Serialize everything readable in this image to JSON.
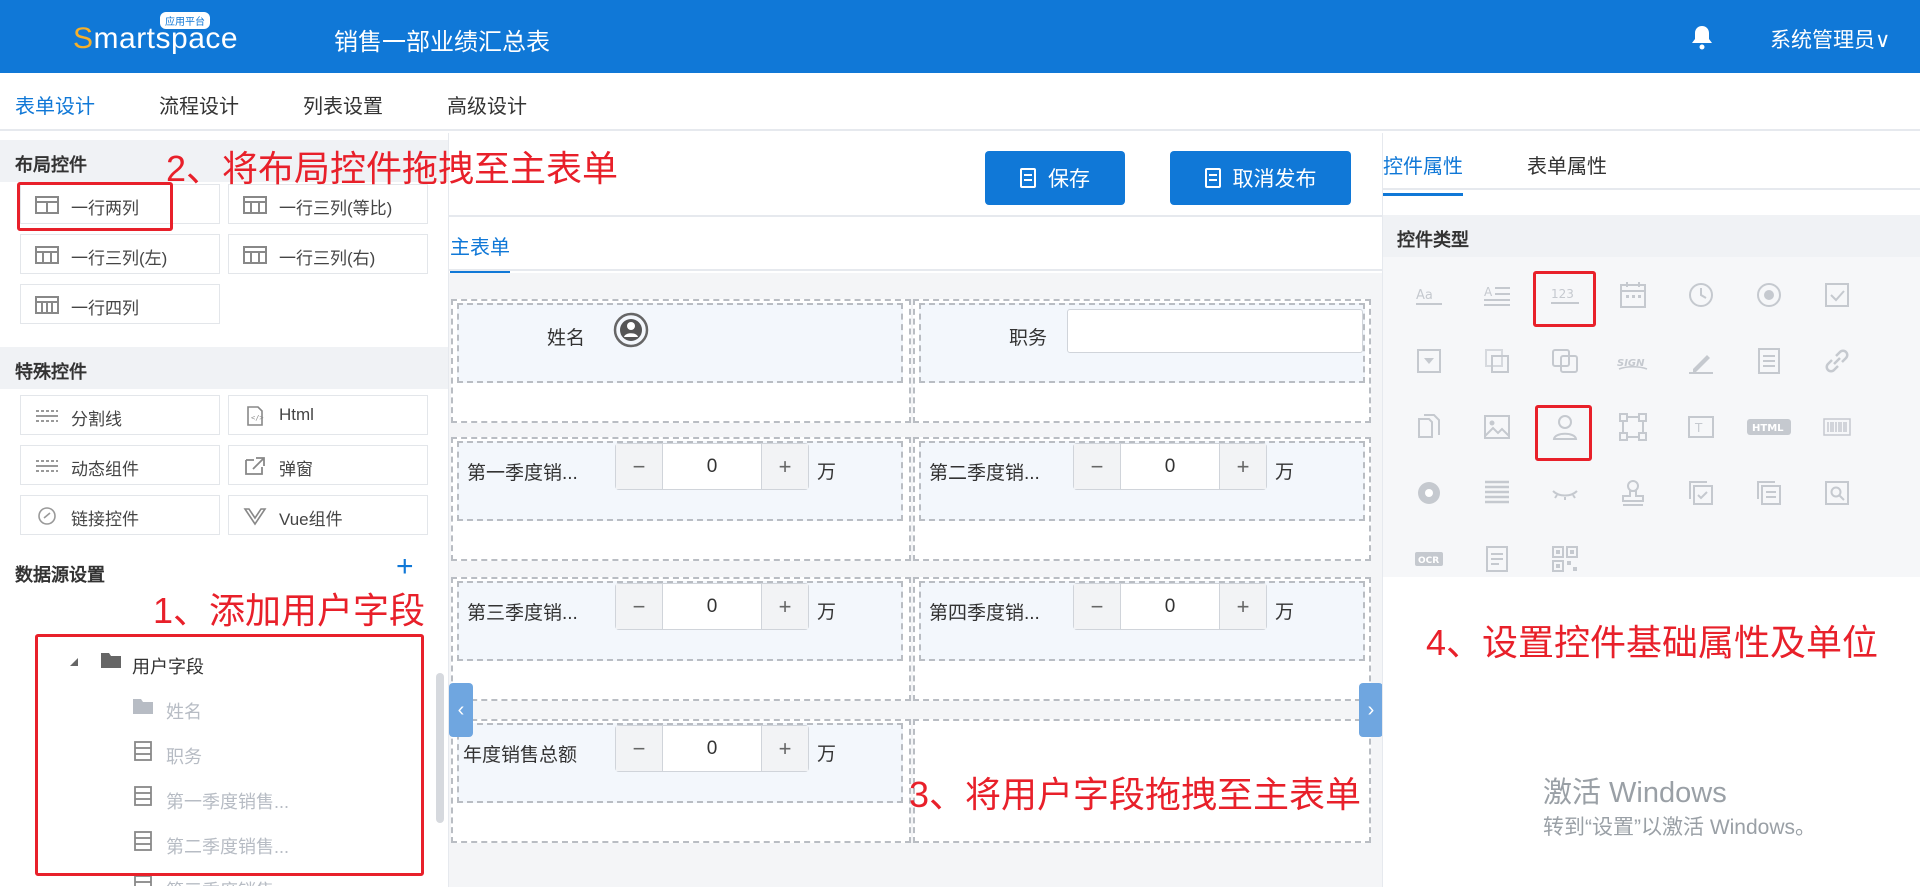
{
  "header": {
    "logo_text": "Smartspace",
    "logo_badge": "应用平台",
    "title": "销售一部业绩汇总表",
    "user_menu": "系统管理员∨",
    "bell_icon": "bell-icon",
    "accent_color": "#1078d7"
  },
  "main_tabs": [
    {
      "label": "表单设计",
      "active": true
    },
    {
      "label": "流程设计"
    },
    {
      "label": "列表设置"
    },
    {
      "label": "高级设计"
    }
  ],
  "left": {
    "layout_section": "布局控件",
    "layout_controls": [
      "一行两列",
      "一行三列(等比)",
      "一行三列(左)",
      "一行三列(右)",
      "一行四列"
    ],
    "special_section": "特殊控件",
    "special_controls": [
      "分割线",
      "Html",
      "动态组件",
      "弹窗",
      "链接控件",
      "Vue组件"
    ],
    "datasource_section": "数据源设置",
    "add_icon": "+",
    "tree": {
      "root": "用户字段",
      "children": [
        "姓名",
        "职务",
        "第一季度销售...",
        "第二季度销售...",
        "第三季度销售..."
      ]
    }
  },
  "center": {
    "save_button": "保存",
    "unpublish_button": "取消发布",
    "form_tab": "主表单",
    "fields": {
      "name_label": "姓名",
      "position_label": "职务",
      "q1_label": "第一季度销...",
      "q2_label": "第二季度销...",
      "q3_label": "第三季度销...",
      "q4_label": "第四季度销...",
      "total_label": "年度销售总额",
      "q1_value": "0",
      "q2_value": "0",
      "q3_value": "0",
      "q4_value": "0",
      "total_value": "0",
      "unit": "万",
      "minus": "−",
      "plus": "+"
    },
    "collapse_left": "‹",
    "collapse_right": "›"
  },
  "right": {
    "tabs": [
      {
        "label": "控件属性",
        "active": true
      },
      {
        "label": "表单属性"
      }
    ],
    "control_type_section": "控件类型",
    "icon_labels": {
      "number": "123",
      "html": "HTML",
      "ocr": "OCR",
      "text": "Aa",
      "signature": "SIGN"
    }
  },
  "watermark": {
    "line1": "激活 Windows",
    "line2": "转到“设置”以激活 Windows。"
  },
  "annotations": {
    "step1": "1、添加用户字段",
    "step2": "2、将布局控件拖拽至主表单",
    "step3": "3、将用户字段拖拽至主表单",
    "step4": "4、设置控件基础属性及单位",
    "color": "#e8202a"
  }
}
